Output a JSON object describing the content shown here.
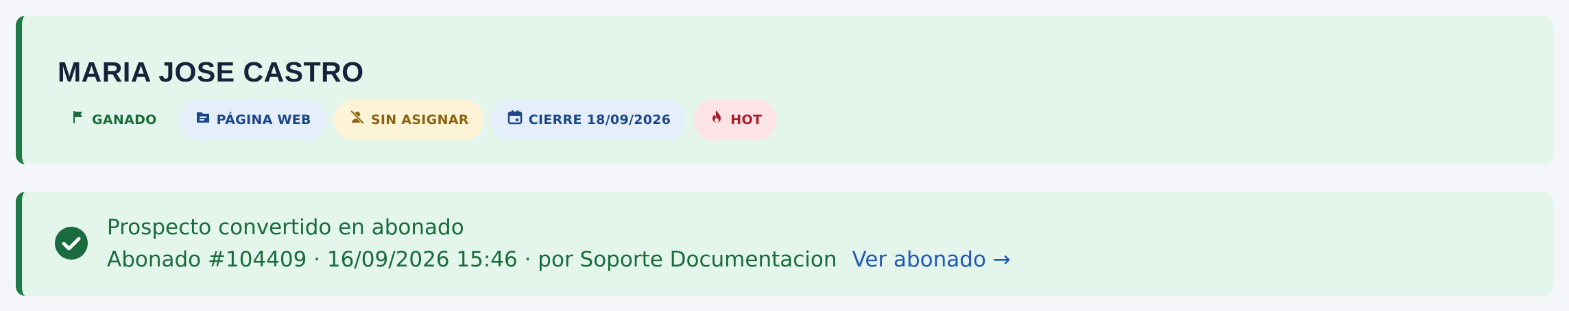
{
  "lead": {
    "name": "MARIA JOSE CASTRO",
    "badges": {
      "status": "GANADO",
      "source": "PÁGINA WEB",
      "assignee": "SIN ASIGNAR",
      "close_date": "CIERRE 18/09/2026",
      "temperature": "HOT"
    },
    "badge_icons": {
      "status": "flag-icon",
      "source": "folder-icon",
      "assignee": "person-off-icon",
      "close_date": "calendar-icon",
      "temperature": "fire-icon"
    }
  },
  "conversion": {
    "title": "Prospecto convertido en abonado",
    "details": "Abonado #104409 · 16/09/2026 15:46 · por Soporte Documentacion",
    "link_label": "Ver abonado →",
    "icon": "check-circle-icon"
  },
  "colors": {
    "card_bg": "#e4f6ec",
    "accent": "#1e7a47",
    "link": "#2458b6"
  }
}
